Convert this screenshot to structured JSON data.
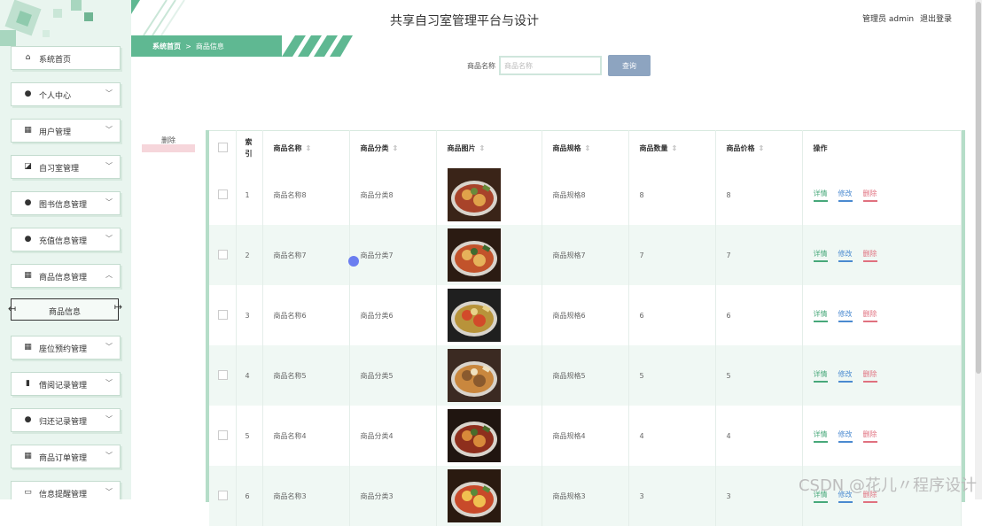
{
  "app": {
    "title": "共享自习室管理平台与设计"
  },
  "header": {
    "user_label": "管理员 admin",
    "logout_label": "退出登录"
  },
  "breadcrumb": {
    "home": "系统首页",
    "separator": ">",
    "current": "商品信息"
  },
  "sidebar": {
    "items": [
      {
        "label": "系统首页",
        "icon": "home-icon",
        "glyph": "⌂",
        "chevron": false
      },
      {
        "label": "个人中心",
        "icon": "person-icon",
        "glyph": "●",
        "chevron": true
      },
      {
        "label": "用户管理",
        "icon": "grid-icon",
        "glyph": "▦",
        "chevron": true
      },
      {
        "label": "自习室管理",
        "icon": "chart-icon",
        "glyph": "◪",
        "chevron": true
      },
      {
        "label": "图书信息管理",
        "icon": "person-icon",
        "glyph": "●",
        "chevron": true
      },
      {
        "label": "充值信息管理",
        "icon": "person-icon",
        "glyph": "●",
        "chevron": true
      },
      {
        "label": "商品信息管理",
        "icon": "grid-icon",
        "glyph": "▦",
        "chevron": true,
        "expanded": true
      },
      {
        "label": "座位预约管理",
        "icon": "grid-icon",
        "glyph": "▦",
        "chevron": true
      },
      {
        "label": "借阅记录管理",
        "icon": "bar-chart-icon",
        "glyph": "▮",
        "chevron": true
      },
      {
        "label": "归还记录管理",
        "icon": "pin-icon",
        "glyph": "●",
        "chevron": true
      },
      {
        "label": "商品订单管理",
        "icon": "grid-icon",
        "glyph": "▦",
        "chevron": true
      },
      {
        "label": "信息提醒管理",
        "icon": "monitor-icon",
        "glyph": "▭",
        "chevron": true
      }
    ],
    "sub_item": "商品信息"
  },
  "search": {
    "label": "商品名称",
    "placeholder": "商品名称",
    "button": "查询"
  },
  "actions": {
    "delete": "删除"
  },
  "table": {
    "headers": [
      "索引",
      "商品名称",
      "商品分类",
      "商品图片",
      "商品规格",
      "商品数量",
      "商品价格",
      "操作"
    ],
    "rows": [
      {
        "index": "1",
        "name": "商品名称8",
        "category": "商品分类8",
        "spec": "商品规格8",
        "qty": "8",
        "price": "8"
      },
      {
        "index": "2",
        "name": "商品名称7",
        "category": "商品分类7",
        "spec": "商品规格7",
        "qty": "7",
        "price": "7"
      },
      {
        "index": "3",
        "name": "商品名称6",
        "category": "商品分类6",
        "spec": "商品规格6",
        "qty": "6",
        "price": "6"
      },
      {
        "index": "4",
        "name": "商品名称5",
        "category": "商品分类5",
        "spec": "商品规格5",
        "qty": "5",
        "price": "5"
      },
      {
        "index": "5",
        "name": "商品名称4",
        "category": "商品分类4",
        "spec": "商品规格4",
        "qty": "4",
        "price": "4"
      },
      {
        "index": "6",
        "name": "商品名称3",
        "category": "商品分类3",
        "spec": "商品规格3",
        "qty": "3",
        "price": "3"
      }
    ],
    "ops": {
      "detail": "详情",
      "edit": "修改",
      "delete": "删除"
    }
  },
  "watermark": "CSDN @花儿〃程序设计",
  "colors": {
    "accent": "#5fb892",
    "sidebar_bg": "#e9f5ef",
    "search_button": "#8da4c0"
  }
}
